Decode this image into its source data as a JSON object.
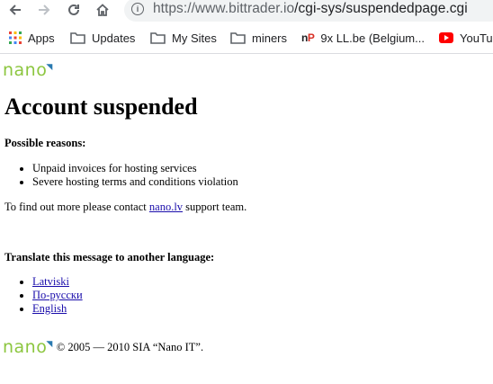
{
  "browser": {
    "url_host": "https://www.bittrader.io",
    "url_path": "/cgi-sys/suspendedpage.cgi",
    "bookmarks": [
      "Apps",
      "Updates",
      "My Sites",
      "miners",
      "9x LL.be (Belgium...",
      "YouTube"
    ]
  },
  "page": {
    "logo_text": "nano",
    "heading": "Account suspended",
    "reasons_title": "Possible reasons:",
    "reasons": [
      "Unpaid invoices for hosting services",
      "Severe hosting terms and conditions violation"
    ],
    "contact_before": "To find out more please contact ",
    "contact_link": "nano.lv",
    "contact_after": " support team.",
    "translate_title": "Translate this message to another language:",
    "languages": [
      "Latviski",
      "По-русски",
      "English"
    ],
    "footer_text": "© 2005 — 2010 SIA “Nano IT”."
  },
  "colors": {
    "logo_green": "#8cc63f",
    "logo_blue": "#2a7ab0",
    "link": "#1a0dab"
  }
}
